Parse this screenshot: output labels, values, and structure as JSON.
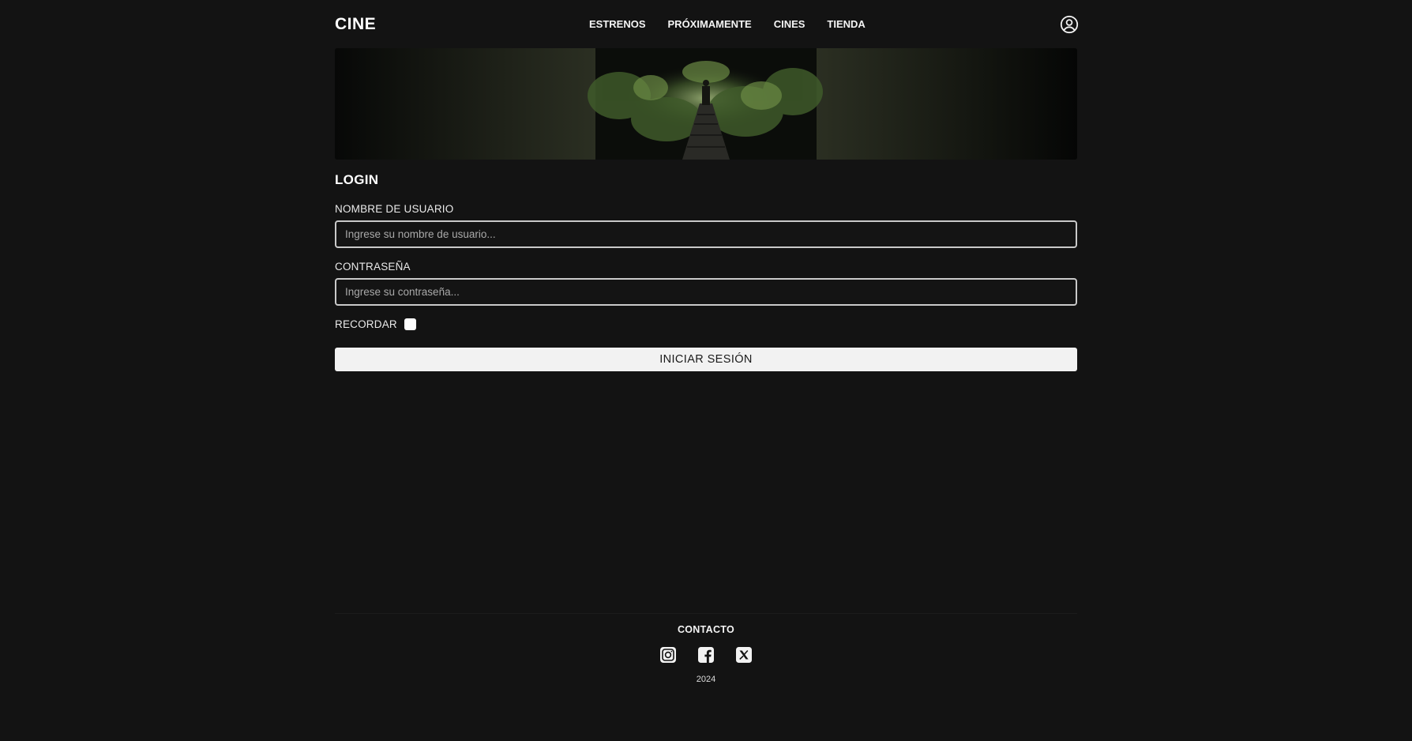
{
  "brand": {
    "logo": "CINE"
  },
  "nav": {
    "items": [
      {
        "label": "ESTRENOS"
      },
      {
        "label": "PRÓXIMAMENTE"
      },
      {
        "label": "CINES"
      },
      {
        "label": "TIENDA"
      }
    ],
    "account_icon": "user-circle-icon"
  },
  "banner": {
    "image": "forest-railway-tunnel-banner"
  },
  "login": {
    "title": "LOGIN",
    "username": {
      "label": "NOMBRE DE USUARIO",
      "placeholder": "Ingrese su nombre de usuario...",
      "value": ""
    },
    "password": {
      "label": "CONTRASEÑA",
      "placeholder": "Ingrese su contraseña...",
      "value": ""
    },
    "remember": {
      "label": "RECORDAR",
      "checked": false
    },
    "submit_label": "INICIAR SESIÓN"
  },
  "footer": {
    "contact_label": "CONTACTO",
    "socials": [
      "instagram-icon",
      "facebook-icon",
      "x-icon"
    ],
    "year": "2024"
  },
  "colors": {
    "background": "#131313",
    "text": "#f2f2f2",
    "input_border": "#c9c9c9",
    "button_bg": "#f2f2f2"
  }
}
